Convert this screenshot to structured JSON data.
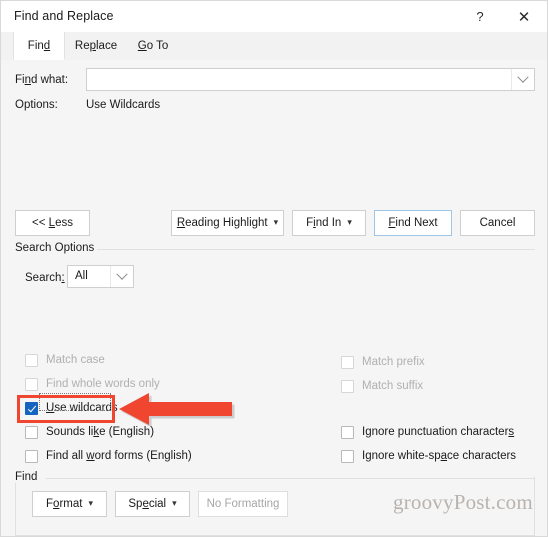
{
  "window": {
    "title": "Find and Replace",
    "help_icon": "?",
    "close_icon": "✕"
  },
  "tabs": [
    {
      "label": "Find",
      "name": "tab-find",
      "active": true
    },
    {
      "label": "Replace",
      "name": "tab-replace",
      "active": false
    },
    {
      "label": "Go To",
      "name": "tab-goto",
      "active": false
    }
  ],
  "find_row": {
    "label": "Find what:",
    "value": "",
    "placeholder": "",
    "dropdown_icon": "chevron-down-icon"
  },
  "options_row": {
    "label": "Options:",
    "value": "Use Wildcards"
  },
  "buttons": {
    "less": "<< Less",
    "reading_highlight": "Reading Highlight",
    "find_in": "Find In",
    "find_next": "Find Next",
    "cancel": "Cancel",
    "caret": "▾"
  },
  "search_options": {
    "group_label": "Search Options",
    "search_label": "Search:",
    "search_value": "All",
    "left_checkboxes": [
      {
        "label": "Match case",
        "checked": false,
        "disabled": true
      },
      {
        "label": "Find whole words only",
        "checked": false,
        "disabled": true
      },
      {
        "label": "Use wildcards",
        "checked": true,
        "disabled": false
      },
      {
        "label": "Sounds like (English)",
        "checked": false,
        "disabled": false
      },
      {
        "label": "Find all word forms (English)",
        "checked": false,
        "disabled": false
      }
    ],
    "right_checkboxes": [
      {
        "label": "Match prefix",
        "checked": false,
        "disabled": true
      },
      {
        "label": "Match suffix",
        "checked": false,
        "disabled": true
      },
      {
        "label": "Ignore punctuation characters",
        "checked": false,
        "disabled": false
      },
      {
        "label": "Ignore white-space characters",
        "checked": false,
        "disabled": false
      }
    ]
  },
  "find_group": {
    "group_label": "Find",
    "format": "Format",
    "special": "Special",
    "no_formatting": "No Formatting"
  },
  "annotation": {
    "highlight_color": "#f0452f",
    "arrow_color": "#f0452f",
    "target": "Use wildcards"
  },
  "watermark": "groovyPost.com"
}
